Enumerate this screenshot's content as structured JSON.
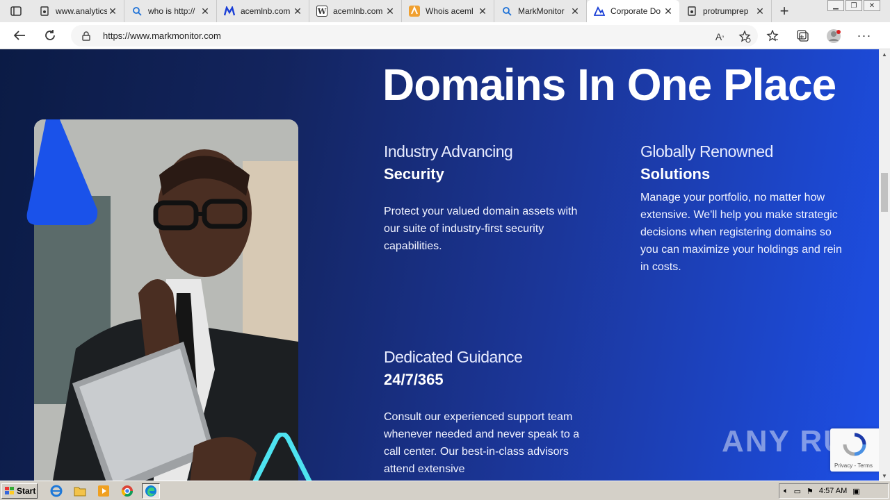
{
  "browser": {
    "tabs": [
      {
        "title": "www.analytics",
        "favicon": "page-icon"
      },
      {
        "title": "who is http://",
        "favicon": "search-icon"
      },
      {
        "title": "acemlnb.com",
        "favicon": "m-logo-icon"
      },
      {
        "title": "acemlnb.com",
        "favicon": "w-logo-icon"
      },
      {
        "title": "Whois aceml",
        "favicon": "whois-icon"
      },
      {
        "title": "MarkMonitor",
        "favicon": "search-icon"
      },
      {
        "title": "Corporate Do",
        "favicon": "markmonitor-icon",
        "active": true
      },
      {
        "title": "protrumprep",
        "favicon": "page-icon"
      }
    ],
    "url": "https://www.markmonitor.com",
    "accent": "#1a4fe0"
  },
  "page": {
    "hero_title": "Domains In One Place",
    "features": [
      {
        "kicker": "Industry Advancing",
        "heading": "Security",
        "desc": "Protect your valued domain assets with our suite of industry-first security capabilities."
      },
      {
        "kicker": "Globally Renowned",
        "heading": "Solutions",
        "desc": "Manage your portfolio, no matter how extensive. We'll help you make strategic decisions when registering domains so you can maximize your holdings and rein in costs."
      },
      {
        "kicker": "Dedicated Guidance",
        "heading": "24/7/365",
        "desc": "Consult our experienced support team whenever needed and never speak to a call center. Our best-in-class advisors attend extensive"
      }
    ],
    "watermark": "ANY RUN",
    "recaptcha_links": "Privacy - Terms"
  },
  "taskbar": {
    "start_label": "Start",
    "clock": "4:57 AM"
  }
}
